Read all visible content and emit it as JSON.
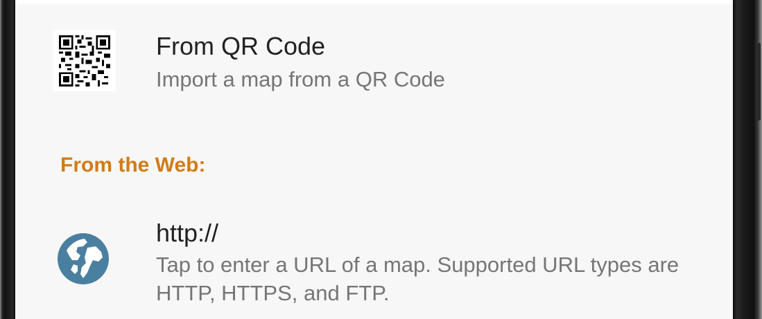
{
  "import_options": {
    "qr": {
      "icon": "qr-code-icon",
      "title": "From QR Code",
      "subtitle": "Import a map from a QR Code"
    },
    "web_section": {
      "header": "From the Web:",
      "header_color": "#d17c16"
    },
    "url": {
      "icon": "globe-icon",
      "icon_color": "#4a7fa0",
      "title": "http://",
      "subtitle": "Tap to enter a URL of a map. Supported URL types are HTTP, HTTPS, and FTP."
    }
  }
}
